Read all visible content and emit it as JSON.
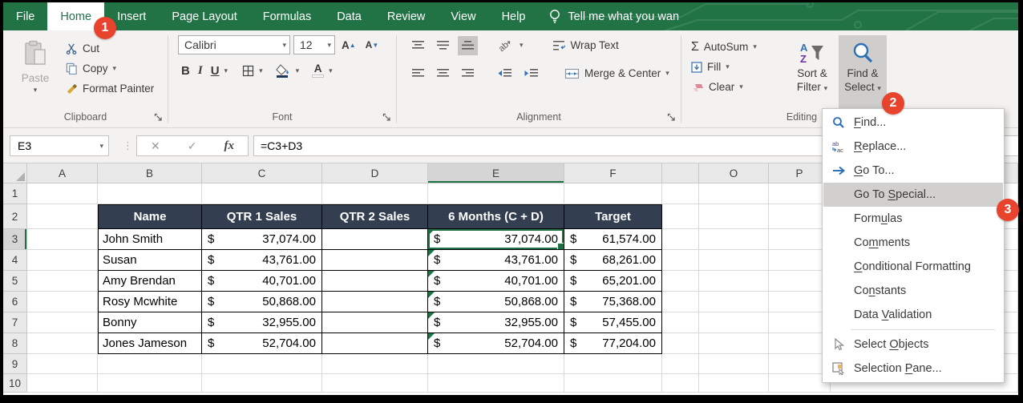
{
  "colors": {
    "excel_green": "#217346",
    "table_header_fill": "#333F50",
    "badge_red": "#E8432D",
    "selection_green": "#1E7145"
  },
  "title_bar": {
    "tabs": [
      {
        "label": "File",
        "active": false
      },
      {
        "label": "Home",
        "active": true
      },
      {
        "label": "Insert",
        "active": false
      },
      {
        "label": "Page Layout",
        "active": false
      },
      {
        "label": "Formulas",
        "active": false
      },
      {
        "label": "Data",
        "active": false
      },
      {
        "label": "Review",
        "active": false
      },
      {
        "label": "View",
        "active": false
      },
      {
        "label": "Help",
        "active": false
      }
    ],
    "tell_me": "Tell me what you wan"
  },
  "ribbon": {
    "clipboard": {
      "label": "Clipboard",
      "paste": "Paste",
      "cut": "Cut",
      "copy": "Copy",
      "format_painter": "Format Painter"
    },
    "font": {
      "label": "Font",
      "font_name": "Calibri",
      "font_size": "12",
      "bold": "B",
      "italic": "I",
      "underline": "U"
    },
    "alignment": {
      "label": "Alignment",
      "wrap_text": "Wrap Text",
      "merge_center": "Merge & Center"
    },
    "editing": {
      "label": "Editing",
      "autosum": "AutoSum",
      "fill": "Fill",
      "clear": "Clear",
      "sort_line1": "Sort &",
      "sort_line2": "Filter",
      "find_line1": "Find &",
      "find_line2": "Select"
    }
  },
  "formula_bar": {
    "name_box": "E3",
    "cancel": "✕",
    "enter": "✓",
    "fx": "fx",
    "formula": "=C3+D3"
  },
  "menu": {
    "items": [
      {
        "pre": "",
        "u": "F",
        "post": "ind...",
        "icon": "find-icon",
        "highlight": false,
        "sep_after": false
      },
      {
        "pre": "",
        "u": "R",
        "post": "eplace...",
        "icon": "replace-icon",
        "highlight": false,
        "sep_after": false
      },
      {
        "pre": "",
        "u": "G",
        "post": "o To...",
        "icon": "goto-icon",
        "highlight": false,
        "sep_after": false
      },
      {
        "pre": "Go To ",
        "u": "S",
        "post": "pecial...",
        "icon": "",
        "highlight": true,
        "sep_after": false
      },
      {
        "pre": "Form",
        "u": "u",
        "post": "las",
        "icon": "",
        "highlight": false,
        "sep_after": false
      },
      {
        "pre": "Co",
        "u": "m",
        "post": "ments",
        "icon": "",
        "highlight": false,
        "sep_after": false
      },
      {
        "pre": "",
        "u": "C",
        "post": "onditional Formatting",
        "icon": "",
        "highlight": false,
        "sep_after": false
      },
      {
        "pre": "Co",
        "u": "n",
        "post": "stants",
        "icon": "",
        "highlight": false,
        "sep_after": false
      },
      {
        "pre": "Data ",
        "u": "V",
        "post": "alidation",
        "icon": "",
        "highlight": false,
        "sep_after": true
      },
      {
        "pre": "Select ",
        "u": "O",
        "post": "bjects",
        "icon": "select-objects-icon",
        "highlight": false,
        "sep_after": false
      },
      {
        "pre": "Selection ",
        "u": "P",
        "post": "ane...",
        "icon": "selection-pane-icon",
        "highlight": false,
        "sep_after": false
      }
    ]
  },
  "grid": {
    "columns": [
      "A",
      "B",
      "C",
      "D",
      "E",
      "F",
      "",
      "O",
      "P",
      ""
    ],
    "selected_column": "E",
    "selected_row": 3,
    "selected_cell": "E3",
    "row_count": 10,
    "currency_symbol": "$",
    "table": {
      "headers": [
        "Name",
        "QTR 1 Sales",
        "QTR 2 Sales",
        "6 Months (C + D)",
        "Target"
      ],
      "rows": [
        {
          "name": "John Smith",
          "qtr1": "37,074.00",
          "qtr2": "",
          "six_months": "37,074.00",
          "target": "61,574.00"
        },
        {
          "name": "Susan",
          "qtr1": "43,761.00",
          "qtr2": "",
          "six_months": "43,761.00",
          "target": "68,261.00"
        },
        {
          "name": "Amy Brendan",
          "qtr1": "40,701.00",
          "qtr2": "",
          "six_months": "40,701.00",
          "target": "65,201.00"
        },
        {
          "name": "Rosy Mcwhite",
          "qtr1": "50,868.00",
          "qtr2": "",
          "six_months": "50,868.00",
          "target": "75,368.00"
        },
        {
          "name": "Bonny",
          "qtr1": "32,955.00",
          "qtr2": "",
          "six_months": "32,955.00",
          "target": "57,455.00"
        },
        {
          "name": "Jones Jameson",
          "qtr1": "52,704.00",
          "qtr2": "",
          "six_months": "52,704.00",
          "target": "77,204.00"
        }
      ]
    }
  },
  "badges": [
    {
      "label": "1"
    },
    {
      "label": "2"
    },
    {
      "label": "3"
    }
  ]
}
